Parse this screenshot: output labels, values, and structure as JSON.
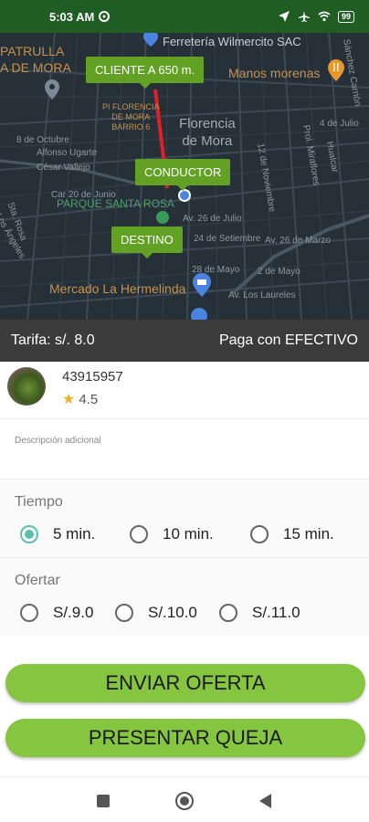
{
  "status_bar": {
    "time": "5:03 AM",
    "battery": "99"
  },
  "map": {
    "bubbles": {
      "client": "CLIENTE A 650 m.",
      "driver": "CONDUCTOR",
      "destination": "DESTINO"
    },
    "labels": {
      "top_left_1": "PATRULLA",
      "top_left_2": "A DE MORA",
      "top_center_1": "Ferretería Wilmercito SAC",
      "manos_morenas": "Manos morenas",
      "pi_florencia": "PI FLORENCIA\nDE MORA\nBARRIO 6",
      "florencia": "Florencia\nde Mora",
      "octubre": "8 de Octubre",
      "alfonso": "Alfonso Ugarte",
      "cesar": "César Vallejo",
      "junio": "Car 20 de Junio",
      "parque": "PARQUE SANTA ROSA",
      "los_angeles": "Los Ángeles",
      "sta_rosa": "Sta. Rosa",
      "julio_26": "Av. 26 de Julio",
      "setiembre": "24 de Setiembre",
      "marzo": "Av. 26 de Marzo",
      "mayo": "28 de Mayo",
      "mayo2": "2 de Mayo",
      "laureles": "Av. Los Laureles",
      "noviembre": "12 de Noviembre",
      "hualcar": "Hualcar",
      "miraflores": "Prol. Miraflores",
      "sanchez_carrion": "Sánchez Carrión",
      "julio_4": "4 de Julio",
      "mercado": "Mercado La Hermelinda"
    }
  },
  "fare_bar": {
    "fare": "Tarifa: s/. 8.0",
    "payment": "Paga con EFECTIVO"
  },
  "client": {
    "id": "43915957",
    "rating": "4.5"
  },
  "description": {
    "placeholder": "Descripción adicional"
  },
  "time_section": {
    "title": "Tiempo",
    "options": [
      "5 min.",
      "10 min.",
      "15 min."
    ],
    "selected": "5 min."
  },
  "offer_section": {
    "title": "Ofertar",
    "options": [
      "S/.9.0",
      "S/.10.0",
      "S/.11.0"
    ]
  },
  "buttons": {
    "send_offer": "ENVIAR OFERTA",
    "complaint": "PRESENTAR QUEJA"
  },
  "colors": {
    "status_bar": "#1f5d22",
    "accent_green": "#86c540",
    "bubble_green": "#62a123",
    "radio_checked": "#5bbfb0",
    "route": "#e21f26"
  }
}
